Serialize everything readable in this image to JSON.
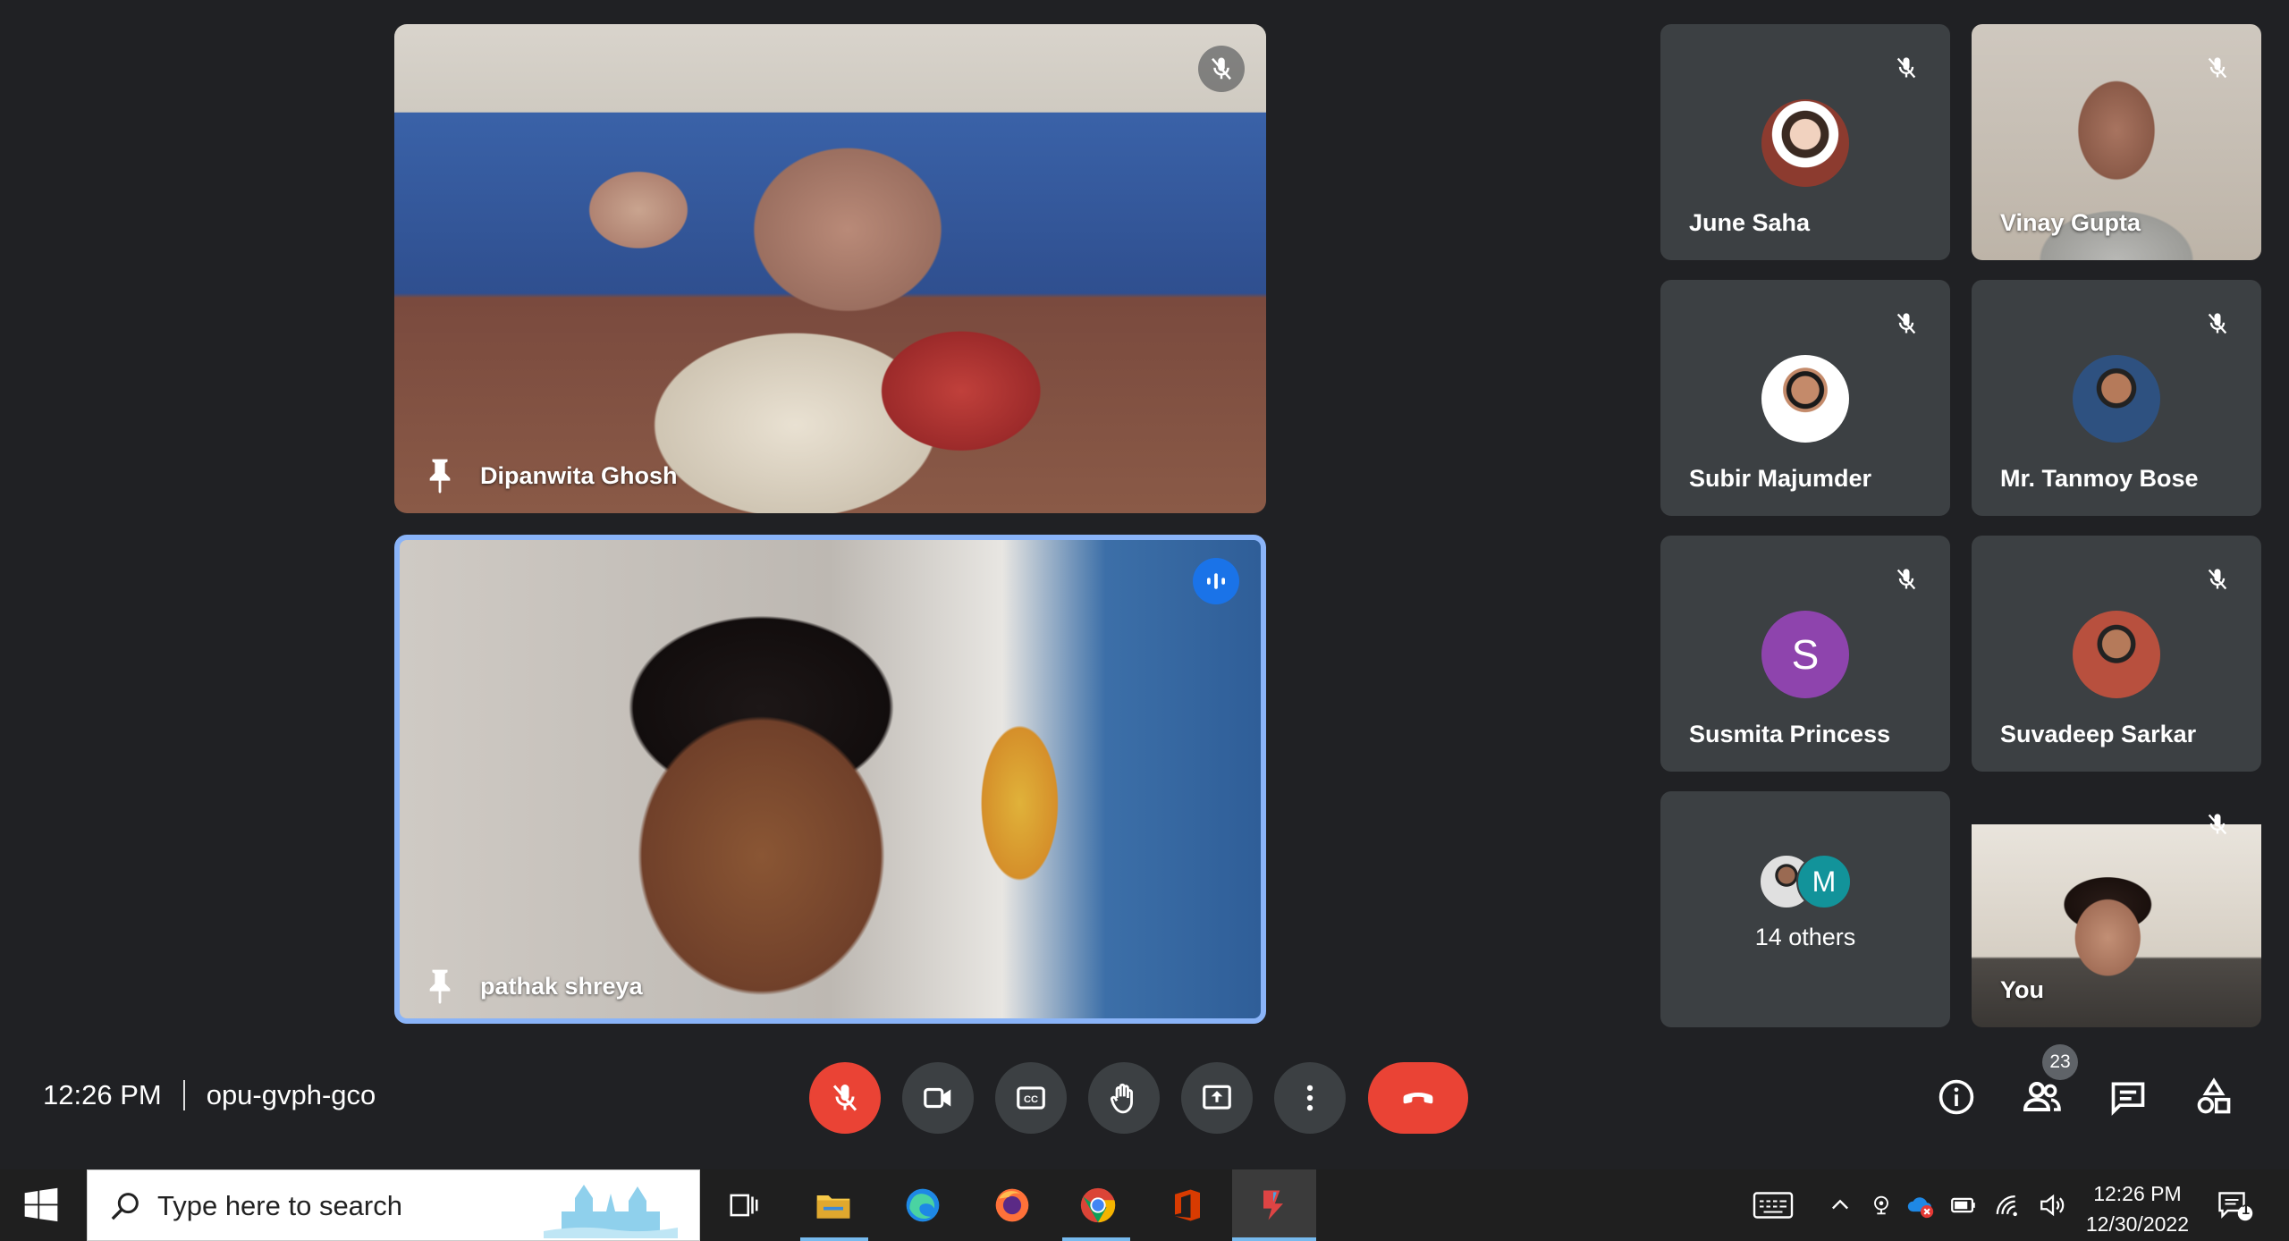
{
  "main_tiles": [
    {
      "name": "Dipanwita Ghosh",
      "pinned": true,
      "muted": true
    },
    {
      "name": "pathak shreya",
      "pinned": true,
      "speaking": true
    }
  ],
  "side_tiles": [
    {
      "name": "June Saha",
      "type": "avatar-photo",
      "muted": true
    },
    {
      "name": "Vinay Gupta",
      "type": "video",
      "muted": true
    },
    {
      "name": "Subir Majumder",
      "type": "avatar-photo",
      "muted": true
    },
    {
      "name": "Mr. Tanmoy Bose",
      "type": "avatar-photo",
      "muted": true
    },
    {
      "name": "Susmita Princess",
      "type": "avatar-letter",
      "letter": "S",
      "muted": true
    },
    {
      "name": "Suvadeep Sarkar",
      "type": "avatar-photo",
      "muted": true
    }
  ],
  "others": {
    "label": "14 others",
    "mini_letter": "M"
  },
  "self_tile": {
    "name": "You",
    "muted": true
  },
  "meeting": {
    "time": "12:26 PM",
    "code": "opu-gvph-gco"
  },
  "controls": {
    "mic": "mic-off-icon",
    "camera": "camera-icon",
    "captions": "captions-icon",
    "raise_hand": "hand-icon",
    "present": "present-icon",
    "more": "more-vert-icon",
    "leave": "call-end-icon"
  },
  "right_controls": {
    "participants_count": "23"
  },
  "taskbar": {
    "search_placeholder": "Type here to search",
    "clock_time": "12:26 PM",
    "clock_date": "12/30/2022",
    "notification_count": "1"
  },
  "colors": {
    "background": "#202124",
    "tile": "#3c4043",
    "danger": "#ea4335",
    "speaking": "#1a73e8",
    "speaking_border": "#8ab4f8",
    "susmita_avatar": "#8e44ad",
    "m_avatar": "#12939a"
  }
}
